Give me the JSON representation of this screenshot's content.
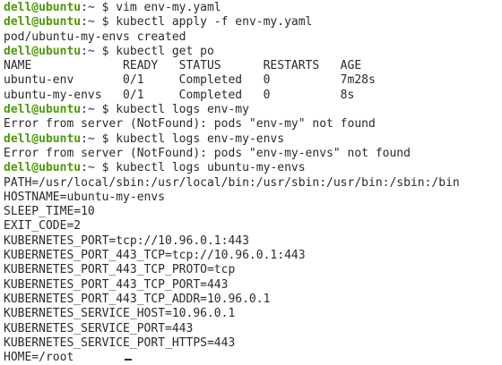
{
  "terminal": {
    "prompt": {
      "user_host": "dell@ubuntu",
      "path": "~",
      "symbol": "$"
    },
    "lines": [
      {
        "type": "cmd",
        "text": "vim env-my.yaml"
      },
      {
        "type": "cmd",
        "text": "kubectl apply -f env-my.yaml"
      },
      {
        "type": "out",
        "text": "pod/ubuntu-my-envs created"
      },
      {
        "type": "cmd",
        "text": "kubectl get po"
      },
      {
        "type": "out",
        "text": "NAME             READY   STATUS      RESTARTS   AGE"
      },
      {
        "type": "out",
        "text": "ubuntu-env       0/1     Completed   0          7m28s"
      },
      {
        "type": "out",
        "text": "ubuntu-my-envs   0/1     Completed   0          8s"
      },
      {
        "type": "cmd",
        "text": "kubectl logs env-my"
      },
      {
        "type": "out",
        "text": "Error from server (NotFound): pods \"env-my\" not found"
      },
      {
        "type": "cmd",
        "text": "kubectl logs env-my-envs"
      },
      {
        "type": "out",
        "text": "Error from server (NotFound): pods \"env-my-envs\" not found"
      },
      {
        "type": "cmd",
        "text": "kubectl logs ubuntu-my-envs"
      },
      {
        "type": "out",
        "text": "PATH=/usr/local/sbin:/usr/local/bin:/usr/sbin:/usr/bin:/sbin:/bin"
      },
      {
        "type": "out",
        "text": "HOSTNAME=ubuntu-my-envs"
      },
      {
        "type": "out",
        "text": "SLEEP_TIME=10"
      },
      {
        "type": "out",
        "text": "EXIT_CODE=2"
      },
      {
        "type": "out",
        "text": "KUBERNETES_PORT=tcp://10.96.0.1:443"
      },
      {
        "type": "out",
        "text": "KUBERNETES_PORT_443_TCP=tcp://10.96.0.1:443"
      },
      {
        "type": "out",
        "text": "KUBERNETES_PORT_443_TCP_PROTO=tcp"
      },
      {
        "type": "out",
        "text": "KUBERNETES_PORT_443_TCP_PORT=443"
      },
      {
        "type": "out",
        "text": "KUBERNETES_PORT_443_TCP_ADDR=10.96.0.1"
      },
      {
        "type": "out",
        "text": "KUBERNETES_SERVICE_HOST=10.96.0.1"
      },
      {
        "type": "out",
        "text": "KUBERNETES_SERVICE_PORT=443"
      },
      {
        "type": "out",
        "text": "KUBERNETES_SERVICE_PORT_HTTPS=443"
      },
      {
        "type": "out",
        "text": "HOME=/root"
      }
    ],
    "colors": {
      "background": "#ffffff",
      "text": "#2a2a2a",
      "prompt_user": "#4e9a06",
      "prompt_path": "#3465a4"
    }
  }
}
